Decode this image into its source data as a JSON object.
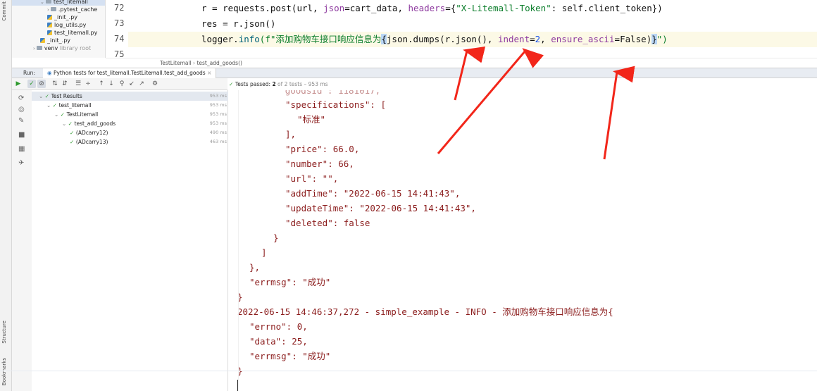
{
  "side_strip": {
    "commit": "Commit",
    "structure": "Structure",
    "bookmarks": "Bookmarks"
  },
  "project_tree": [
    {
      "label": "test_litemall",
      "indent": 0,
      "kind": "folder",
      "expanded": true,
      "selected": true
    },
    {
      "label": ".pytest_cache",
      "indent": 1,
      "kind": "folder",
      "expanded": false
    },
    {
      "label": "_init_.py",
      "indent": 1,
      "kind": "py"
    },
    {
      "label": "log_utils.py",
      "indent": 1,
      "kind": "py"
    },
    {
      "label": "test_litemall.py",
      "indent": 1,
      "kind": "py"
    },
    {
      "label": "_init_.py",
      "indent": 0,
      "kind": "py"
    },
    {
      "label": "venv",
      "suffix": "library root",
      "indent": -1,
      "kind": "folder",
      "expanded": false
    }
  ],
  "editor": {
    "lines": [
      {
        "num": "72",
        "segments": [
          {
            "t": "r = requests.post(url, "
          },
          {
            "t": "json",
            "c": "param"
          },
          {
            "t": "=cart_data, "
          },
          {
            "t": "headers",
            "c": "param"
          },
          {
            "t": "={"
          },
          {
            "t": "\"X-Litemall-Token\"",
            "c": "str"
          },
          {
            "t": ": self.client_token})"
          }
        ]
      },
      {
        "num": "73",
        "segments": [
          {
            "t": "res = r.json()"
          }
        ]
      },
      {
        "num": "74",
        "current": true,
        "segments": [
          {
            "t": "logger."
          },
          {
            "t": "info",
            "c": "fn"
          },
          {
            "t": "(f\"添加购物车接口响应信息为",
            "c": "str"
          },
          {
            "t": "{",
            "c": "brace"
          },
          {
            "t": "json.dumps(r.json(), "
          },
          {
            "t": "indent",
            "c": "param"
          },
          {
            "t": "="
          },
          {
            "t": "2",
            "c": "num"
          },
          {
            "t": ", "
          },
          {
            "t": "ensure_ascii",
            "c": "param"
          },
          {
            "t": "=False)"
          },
          {
            "t": "}",
            "c": "brace"
          },
          {
            "t": "\")",
            "c": "str"
          }
        ]
      },
      {
        "num": "75",
        "segments": []
      }
    ],
    "breadcrumb": [
      "TestLitemall",
      "test_add_goods()"
    ]
  },
  "run": {
    "label": "Run:",
    "tab_title": "Python tests for test_litemall.TestLitemall.test_add_goods",
    "status_prefix": "Tests passed:",
    "status_count": "2",
    "status_suffix": "of 2 tests – 953 ms"
  },
  "test_tree": [
    {
      "label": "Test Results",
      "indent": 0,
      "time": "953 ms",
      "selected": true
    },
    {
      "label": "test_litemall",
      "indent": 1,
      "time": "953 ms"
    },
    {
      "label": "TestLitemall",
      "indent": 2,
      "time": "953 ms"
    },
    {
      "label": "test_add_goods",
      "indent": 3,
      "time": "953 ms"
    },
    {
      "label": "(ADcarry12)",
      "indent": 4,
      "time": "490 ms"
    },
    {
      "label": "(ADcarry13)",
      "indent": 4,
      "time": "463 ms"
    }
  ],
  "console_lines": [
    {
      "indent": 8,
      "text": "\"specifications\": ["
    },
    {
      "indent": 10,
      "text": "\"标准\""
    },
    {
      "indent": 8,
      "text": "],"
    },
    {
      "indent": 8,
      "text": "\"price\": 66.0,"
    },
    {
      "indent": 8,
      "text": "\"number\": 66,"
    },
    {
      "indent": 8,
      "text": "\"url\": \"\","
    },
    {
      "indent": 8,
      "text": "\"addTime\": \"2022-06-15 14:41:43\","
    },
    {
      "indent": 8,
      "text": "\"updateTime\": \"2022-06-15 14:41:43\","
    },
    {
      "indent": 8,
      "text": "\"deleted\": false"
    },
    {
      "indent": 6,
      "text": "}"
    },
    {
      "indent": 4,
      "text": "]"
    },
    {
      "indent": 2,
      "text": "},"
    },
    {
      "indent": 2,
      "text": "\"errmsg\": \"成功\""
    },
    {
      "indent": 0,
      "text": "}"
    },
    {
      "indent": 0,
      "text": "2022-06-15 14:46:37,272 - simple_example - INFO - 添加购物车接口响应信息为{"
    },
    {
      "indent": 2,
      "text": "\"errno\": 0,"
    },
    {
      "indent": 2,
      "text": "\"data\": 25,"
    },
    {
      "indent": 2,
      "text": "\"errmsg\": \"成功\""
    },
    {
      "indent": 0,
      "text": "}"
    }
  ],
  "colors": {
    "annotation_arrow": "#f2261a",
    "console_text": "#8b1c1c",
    "pass_green": "#2e9a2e"
  }
}
